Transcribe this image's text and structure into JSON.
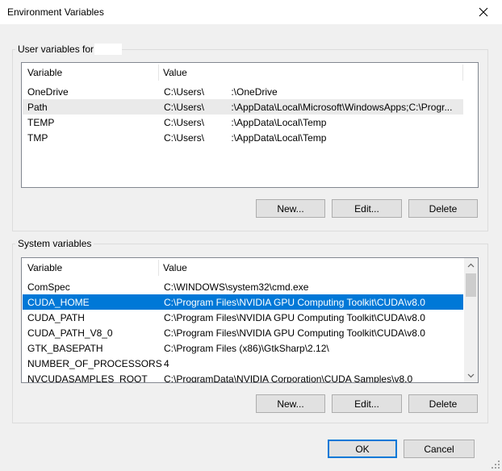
{
  "window": {
    "title": "Environment Variables",
    "close_icon": "close-icon"
  },
  "user_vars": {
    "label": "User variables for",
    "columns": [
      "Variable",
      "Value"
    ],
    "rows": [
      {
        "variable": "OneDrive",
        "value": "C:\\Users\\          :\\OneDrive"
      },
      {
        "variable": "Path",
        "value": "C:\\Users\\          :\\AppData\\Local\\Microsoft\\WindowsApps;C:\\Progr..."
      },
      {
        "variable": "TEMP",
        "value": "C:\\Users\\          :\\AppData\\Local\\Temp"
      },
      {
        "variable": "TMP",
        "value": "C:\\Users\\          :\\AppData\\Local\\Temp"
      }
    ],
    "buttons": {
      "new": "New...",
      "edit": "Edit...",
      "delete": "Delete"
    }
  },
  "system_vars": {
    "label": "System variables",
    "columns": [
      "Variable",
      "Value"
    ],
    "rows": [
      {
        "variable": "ComSpec",
        "value": "C:\\WINDOWS\\system32\\cmd.exe"
      },
      {
        "variable": "CUDA_HOME",
        "value": "C:\\Program Files\\NVIDIA GPU Computing Toolkit\\CUDA\\v8.0"
      },
      {
        "variable": "CUDA_PATH",
        "value": "C:\\Program Files\\NVIDIA GPU Computing Toolkit\\CUDA\\v8.0"
      },
      {
        "variable": "CUDA_PATH_V8_0",
        "value": "C:\\Program Files\\NVIDIA GPU Computing Toolkit\\CUDA\\v8.0"
      },
      {
        "variable": "GTK_BASEPATH",
        "value": "C:\\Program Files (x86)\\GtkSharp\\2.12\\"
      },
      {
        "variable": "NUMBER_OF_PROCESSORS",
        "value": "4"
      },
      {
        "variable": "NVCUDASAMPLES_ROOT",
        "value": "C:\\ProgramData\\NVIDIA Corporation\\CUDA Samples\\v8.0"
      }
    ],
    "selected_row": "CUDA_HOME",
    "buttons": {
      "new": "New...",
      "edit": "Edit...",
      "delete": "Delete"
    }
  },
  "footer": {
    "ok": "OK",
    "cancel": "Cancel"
  },
  "colors": {
    "selection": "#0078d7",
    "background": "#f0f0f0"
  }
}
